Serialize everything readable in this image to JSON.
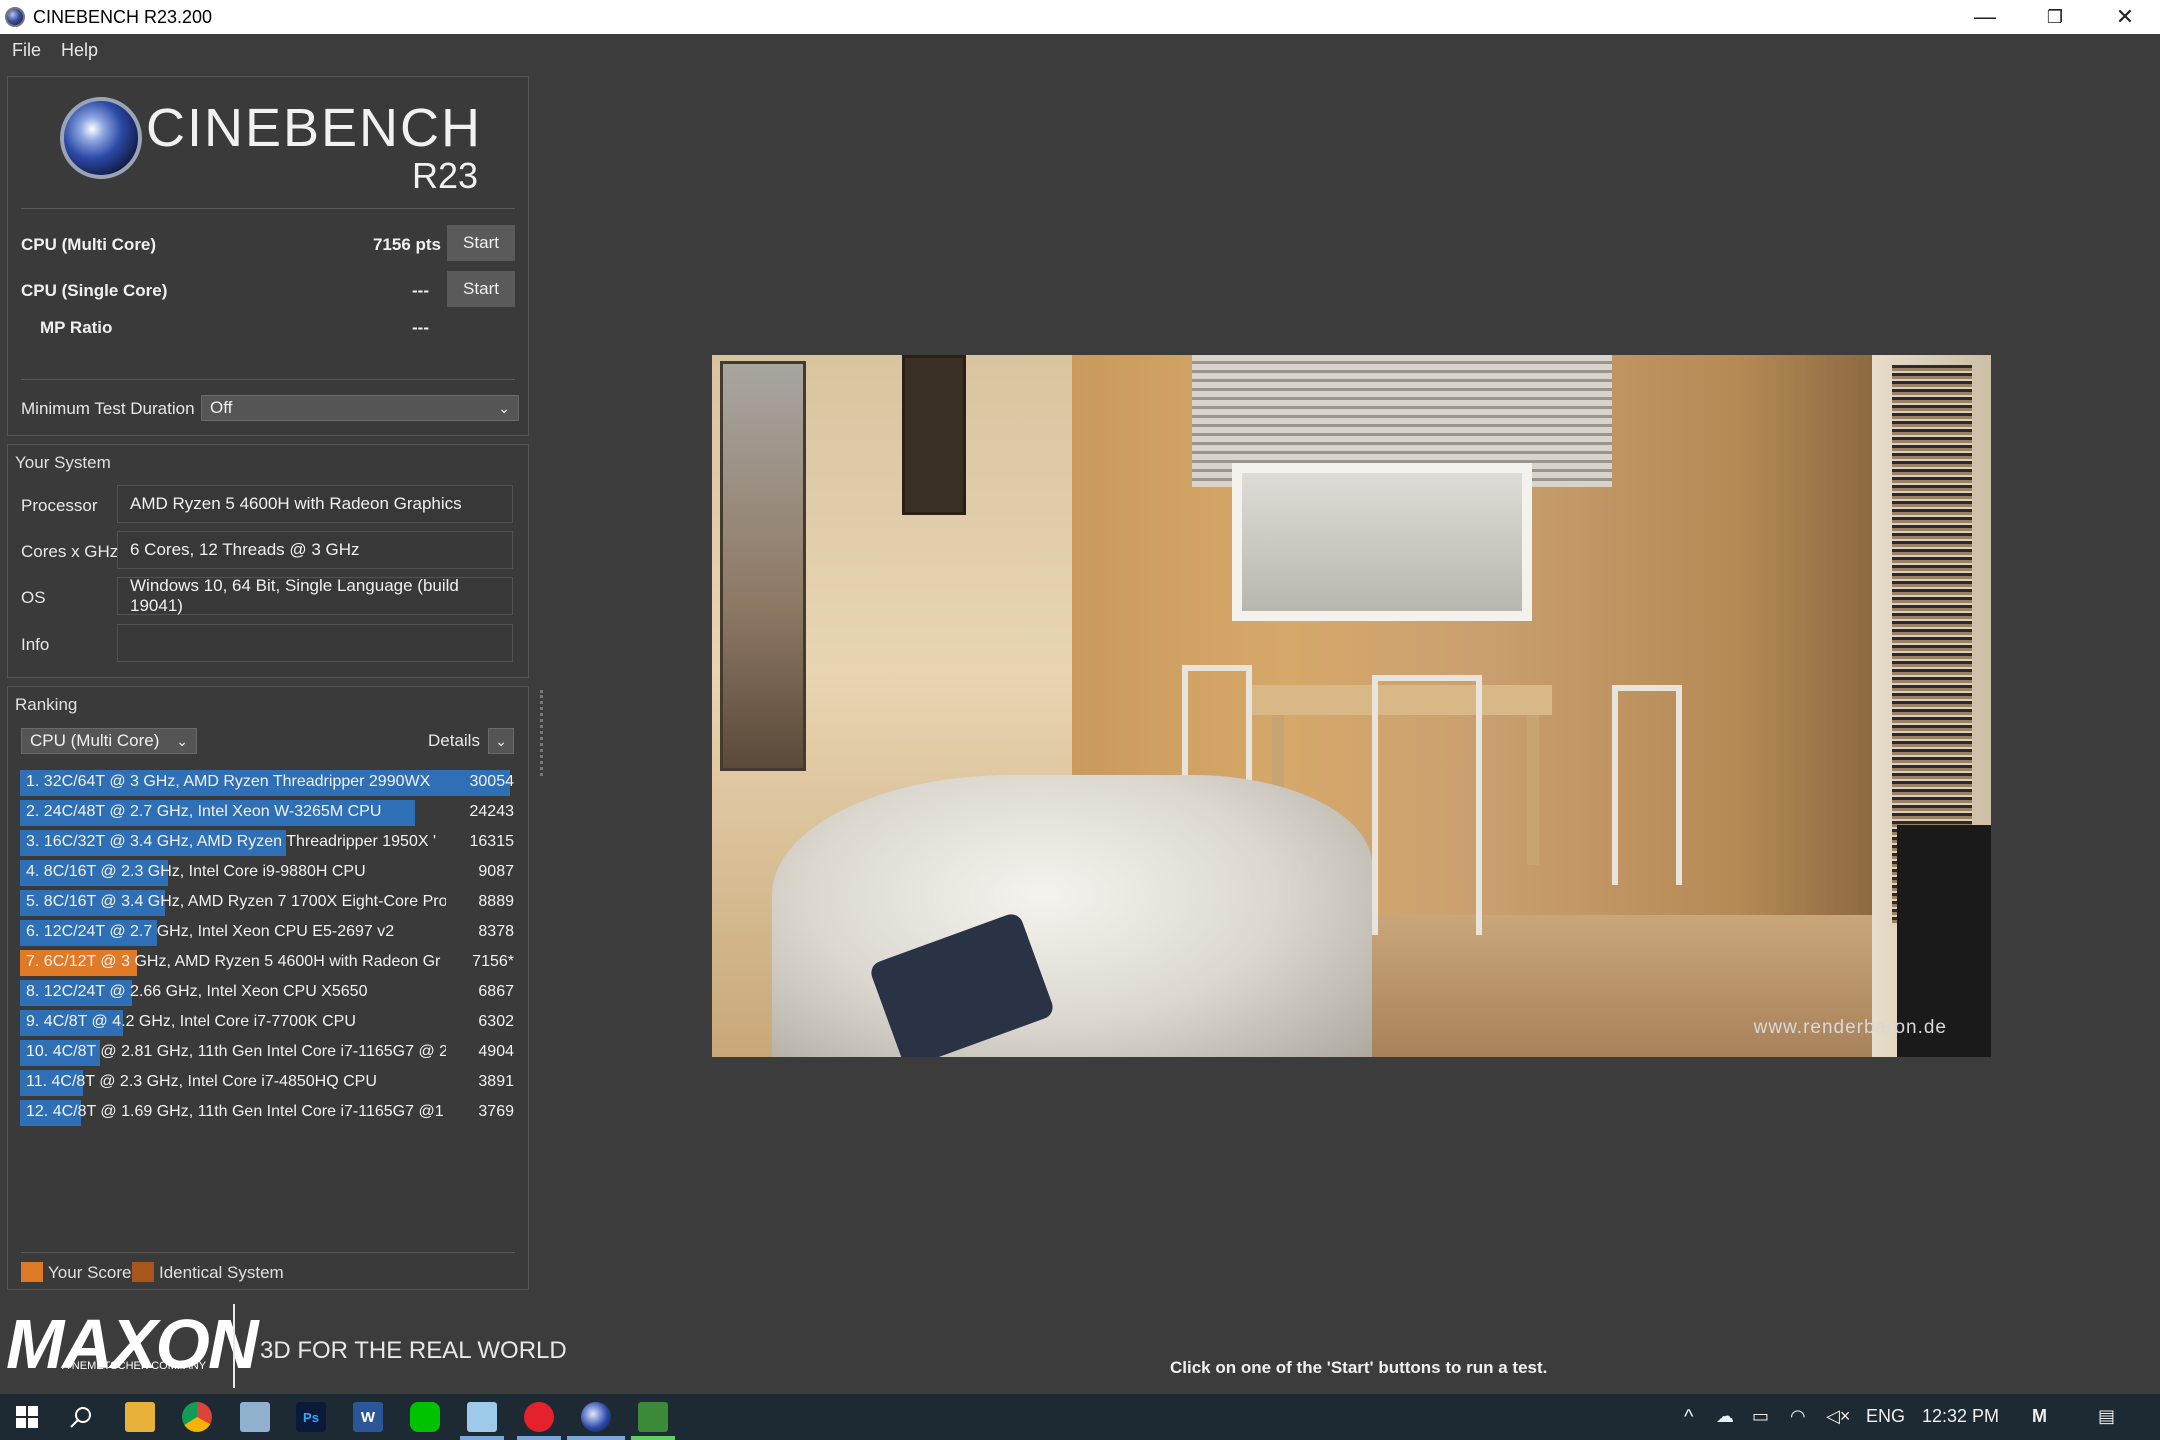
{
  "window": {
    "title": "CINEBENCH R23.200",
    "minimize": "—",
    "restore": "❐",
    "close": "✕"
  },
  "menu": {
    "file": "File",
    "help": "Help"
  },
  "logo": {
    "word": "CINEBENCH",
    "version": "R23"
  },
  "tests": {
    "multi_label": "CPU (Multi Core)",
    "multi_value": "7156 pts",
    "single_label": "CPU (Single Core)",
    "single_value": "---",
    "mp_label": "MP Ratio",
    "mp_value": "---",
    "start_label": "Start"
  },
  "min_duration": {
    "label": "Minimum Test Duration",
    "value": "Off"
  },
  "system": {
    "title": "Your System",
    "processor_label": "Processor",
    "processor_value": "AMD Ryzen 5 4600H with Radeon Graphics",
    "cores_label": "Cores x GHz",
    "cores_value": "6 Cores, 12 Threads @ 3 GHz",
    "os_label": "OS",
    "os_value": "Windows 10, 64 Bit, Single Language (build 19041)",
    "info_label": "Info",
    "info_value": ""
  },
  "ranking": {
    "title": "Ranking",
    "mode": "CPU (Multi Core)",
    "details": "Details",
    "max_score": 30054,
    "items": [
      {
        "text": "1. 32C/64T @ 3 GHz, AMD Ryzen Threadripper 2990WX",
        "score": "30054",
        "value": 30054,
        "mine": false
      },
      {
        "text": "2. 24C/48T @ 2.7 GHz, Intel Xeon W-3265M CPU",
        "score": "24243",
        "value": 24243,
        "mine": false
      },
      {
        "text": "3. 16C/32T @ 3.4 GHz, AMD Ryzen Threadripper 1950X '",
        "score": "16315",
        "value": 16315,
        "mine": false
      },
      {
        "text": "4. 8C/16T @ 2.3 GHz, Intel Core i9-9880H CPU",
        "score": "9087",
        "value": 9087,
        "mine": false
      },
      {
        "text": "5. 8C/16T @ 3.4 GHz, AMD Ryzen 7 1700X Eight-Core Pro",
        "score": "8889",
        "value": 8889,
        "mine": false
      },
      {
        "text": "6. 12C/24T @ 2.7 GHz, Intel Xeon CPU E5-2697 v2",
        "score": "8378",
        "value": 8378,
        "mine": false
      },
      {
        "text": "7. 6C/12T @ 3 GHz, AMD Ryzen 5 4600H with Radeon Gr",
        "score": "7156*",
        "value": 7156,
        "mine": true
      },
      {
        "text": "8. 12C/24T @ 2.66 GHz, Intel Xeon CPU X5650",
        "score": "6867",
        "value": 6867,
        "mine": false
      },
      {
        "text": "9. 4C/8T @ 4.2 GHz, Intel Core i7-7700K CPU",
        "score": "6302",
        "value": 6302,
        "mine": false
      },
      {
        "text": "10. 4C/8T @ 2.81 GHz, 11th Gen Intel Core i7-1165G7 @ 2",
        "score": "4904",
        "value": 4904,
        "mine": false
      },
      {
        "text": "11. 4C/8T @ 2.3 GHz, Intel Core i7-4850HQ CPU",
        "score": "3891",
        "value": 3891,
        "mine": false
      },
      {
        "text": "12. 4C/8T @ 1.69 GHz, 11th Gen Intel Core i7-1165G7 @1",
        "score": "3769",
        "value": 3769,
        "mine": false
      }
    ],
    "legend_your": "Your Score",
    "legend_identical": "Identical System"
  },
  "colors": {
    "bar_blue": "#2f6fb5",
    "bar_orange": "#e17a26",
    "identical": "#a8561c"
  },
  "footer": {
    "brand": "MAXON",
    "sub": "A NEMETSCHEK COMPANY",
    "tagline": "3D FOR THE REAL WORLD"
  },
  "render": {
    "watermark": "www.renderbaron.de"
  },
  "status": "Click on one of the 'Start' buttons to run a test.",
  "taskbar": {
    "language": "ENG",
    "time": "12:32 PM",
    "icons": [
      "windows-start-icon",
      "search-icon",
      "file-explorer-icon",
      "chrome-icon",
      "calculator-icon",
      "photoshop-icon",
      "word-icon",
      "line-icon",
      "app-icon",
      "opera-icon",
      "cinebench-icon",
      "game-icon"
    ]
  }
}
